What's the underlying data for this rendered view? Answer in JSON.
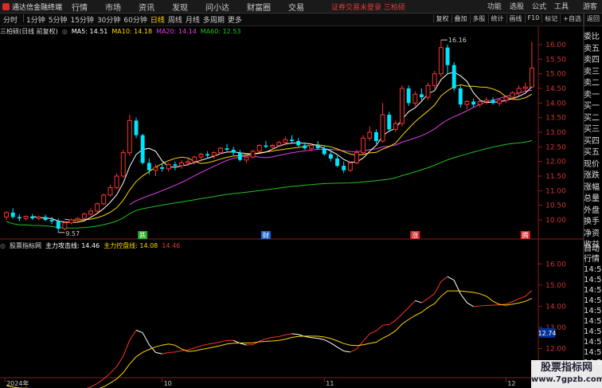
{
  "app": {
    "title": "通达信金融终端"
  },
  "menu": [
    "行情",
    "市场",
    "资讯",
    "发现",
    "问小达",
    "财富圈",
    "交易"
  ],
  "alert": "证券交易未登录 三柏硕",
  "top_right": {
    "items": [
      "功能",
      "选股",
      "公式",
      "工具"
    ],
    "guest": "游客"
  },
  "period_tabs": [
    "分时",
    "1分钟",
    "5分钟",
    "15分钟",
    "30分钟",
    "60分钟",
    "日线",
    "周线",
    "月线",
    "多周期",
    "更多"
  ],
  "active_period": "日线",
  "right_tools": [
    "复权",
    "叠加",
    "多股",
    "统计",
    "画线",
    "F10",
    "标记",
    "+自选",
    "返回"
  ],
  "main_legend": {
    "name": "三柏硕(日线 前复权)",
    "ma5": "MA5: 14.51",
    "ma10": "MA10: 14.18",
    "ma20": "MA20: 14.14",
    "ma60": "MA60: 12.53",
    "colors": {
      "ma5": "#ffffff",
      "ma10": "#ffd400",
      "ma20": "#e040e0",
      "ma60": "#22c022"
    }
  },
  "sub_legend": {
    "name": "股票指标网",
    "attack": "主力攻击线: 14.46",
    "control": "主力控盘线: 14.08",
    "extra": "14.46"
  },
  "main_axis": [
    "16.00",
    "15.50",
    "15.00",
    "14.50",
    "14.00",
    "13.50",
    "13.00",
    "12.50",
    "12.00",
    "11.50",
    "11.00",
    "10.50",
    "10.00"
  ],
  "sub_axis": [
    "16.00",
    "15.00",
    "14.00",
    "13.00",
    "12.00",
    "11.00"
  ],
  "sub_marker": "12.74",
  "annotations": {
    "high": "16.16",
    "low": "9.57"
  },
  "events": [
    "跌",
    "财",
    "涨",
    "腾"
  ],
  "date_labels": [
    "2024年",
    "10",
    "11",
    "12"
  ],
  "side_panel": {
    "main": [
      "委比",
      "卖五",
      "卖四",
      "卖三",
      "卖二",
      "卖一",
      "买一",
      "买二",
      "买三",
      "买四",
      "买五",
      "现价",
      "涨跌",
      "涨幅",
      "总量",
      "外盘",
      "换手",
      "净资",
      "收益"
    ],
    "sub": [
      "自动",
      "行情",
      "14:56",
      "14:56",
      "14:56",
      "14:56",
      "14:56",
      "14:56",
      "14:56",
      "14:56",
      "14:56",
      "14:56"
    ]
  },
  "watermark": {
    "line1": "股票指标网",
    "line2": "www.7gpzb.com"
  },
  "chart_data": {
    "type": "candlestick",
    "candles": [
      [
        10.1,
        10.3,
        10.0,
        10.25
      ],
      [
        10.25,
        10.4,
        10.05,
        10.1
      ],
      [
        10.1,
        10.2,
        9.95,
        10.05
      ],
      [
        10.05,
        10.15,
        9.98,
        10.12
      ],
      [
        10.12,
        10.2,
        10.0,
        10.05
      ],
      [
        10.05,
        10.15,
        9.98,
        10.1
      ],
      [
        10.1,
        10.18,
        9.95,
        10.0
      ],
      [
        10.0,
        10.1,
        9.85,
        9.95
      ],
      [
        9.95,
        10.05,
        9.57,
        9.7
      ],
      [
        9.7,
        9.95,
        9.65,
        9.9
      ],
      [
        9.9,
        10.05,
        9.85,
        10.0
      ],
      [
        10.0,
        10.1,
        9.95,
        10.05
      ],
      [
        10.05,
        10.25,
        10.0,
        10.2
      ],
      [
        10.2,
        10.4,
        10.15,
        10.3
      ],
      [
        10.3,
        10.6,
        10.25,
        10.55
      ],
      [
        10.55,
        10.9,
        10.5,
        10.85
      ],
      [
        10.85,
        11.2,
        10.8,
        11.1
      ],
      [
        11.1,
        11.6,
        11.05,
        11.5
      ],
      [
        11.5,
        12.4,
        11.45,
        12.3
      ],
      [
        12.3,
        13.6,
        12.2,
        13.4
      ],
      [
        13.4,
        13.5,
        12.8,
        12.9
      ],
      [
        12.9,
        12.95,
        11.9,
        11.95
      ],
      [
        11.95,
        12.1,
        11.55,
        11.7
      ],
      [
        11.7,
        11.9,
        11.5,
        11.8
      ],
      [
        11.8,
        11.95,
        11.65,
        11.75
      ],
      [
        11.75,
        11.95,
        11.65,
        11.9
      ],
      [
        11.9,
        12.0,
        11.7,
        11.85
      ],
      [
        11.85,
        12.05,
        11.75,
        11.95
      ],
      [
        11.95,
        12.1,
        11.85,
        12.0
      ],
      [
        12.0,
        12.2,
        11.9,
        12.15
      ],
      [
        12.15,
        12.3,
        12.0,
        12.25
      ],
      [
        12.25,
        12.35,
        12.1,
        12.2
      ],
      [
        12.2,
        12.35,
        12.1,
        12.3
      ],
      [
        12.3,
        12.5,
        12.25,
        12.45
      ],
      [
        12.45,
        12.6,
        12.35,
        12.4
      ],
      [
        12.4,
        12.5,
        12.2,
        12.3
      ],
      [
        12.3,
        12.4,
        12.0,
        12.05
      ],
      [
        12.05,
        12.2,
        11.95,
        12.15
      ],
      [
        12.15,
        12.4,
        12.1,
        12.35
      ],
      [
        12.35,
        12.6,
        12.3,
        12.55
      ],
      [
        12.55,
        12.7,
        12.45,
        12.5
      ],
      [
        12.5,
        12.6,
        12.4,
        12.55
      ],
      [
        12.55,
        12.7,
        12.5,
        12.65
      ],
      [
        12.65,
        12.85,
        12.55,
        12.75
      ],
      [
        12.75,
        12.9,
        12.6,
        12.7
      ],
      [
        12.7,
        12.8,
        12.5,
        12.55
      ],
      [
        12.55,
        12.65,
        12.4,
        12.45
      ],
      [
        12.45,
        12.6,
        12.35,
        12.55
      ],
      [
        12.55,
        12.7,
        12.4,
        12.45
      ],
      [
        12.45,
        12.55,
        12.2,
        12.25
      ],
      [
        12.25,
        12.4,
        12.0,
        12.1
      ],
      [
        12.1,
        12.2,
        11.8,
        11.85
      ],
      [
        11.85,
        12.0,
        11.6,
        11.7
      ],
      [
        11.7,
        12.0,
        11.65,
        11.95
      ],
      [
        11.95,
        12.4,
        11.9,
        12.3
      ],
      [
        12.3,
        12.9,
        12.25,
        12.8
      ],
      [
        12.8,
        13.2,
        12.7,
        13.0
      ],
      [
        13.0,
        13.1,
        12.6,
        12.7
      ],
      [
        12.7,
        14.0,
        12.65,
        13.6
      ],
      [
        13.6,
        13.7,
        13.0,
        13.1
      ],
      [
        13.1,
        13.4,
        13.0,
        13.3
      ],
      [
        13.3,
        14.6,
        13.2,
        14.5
      ],
      [
        14.5,
        14.6,
        13.9,
        14.0
      ],
      [
        14.0,
        14.4,
        13.9,
        14.3
      ],
      [
        14.3,
        14.5,
        14.1,
        14.2
      ],
      [
        14.2,
        14.7,
        14.1,
        14.6
      ],
      [
        14.6,
        15.1,
        14.5,
        15.0
      ],
      [
        15.0,
        16.16,
        14.9,
        15.9
      ],
      [
        15.9,
        16.0,
        15.0,
        15.3
      ],
      [
        15.3,
        15.4,
        14.4,
        14.5
      ],
      [
        14.5,
        14.6,
        13.85,
        13.95
      ],
      [
        13.95,
        14.1,
        13.8,
        14.05
      ],
      [
        14.05,
        14.15,
        13.85,
        13.95
      ],
      [
        13.95,
        14.1,
        13.85,
        14.05
      ],
      [
        14.05,
        14.2,
        13.95,
        14.1
      ],
      [
        14.1,
        14.2,
        13.95,
        14.0
      ],
      [
        14.0,
        14.15,
        13.9,
        14.1
      ],
      [
        14.1,
        14.25,
        14.0,
        14.2
      ],
      [
        14.2,
        14.4,
        14.1,
        14.35
      ],
      [
        14.35,
        14.6,
        14.25,
        14.5
      ],
      [
        14.5,
        14.7,
        14.4,
        14.55
      ],
      [
        14.55,
        16.1,
        14.5,
        15.2
      ]
    ],
    "ylim": [
      9.4,
      16.3
    ],
    "sub_ylim": [
      10.7,
      16.5
    ]
  }
}
